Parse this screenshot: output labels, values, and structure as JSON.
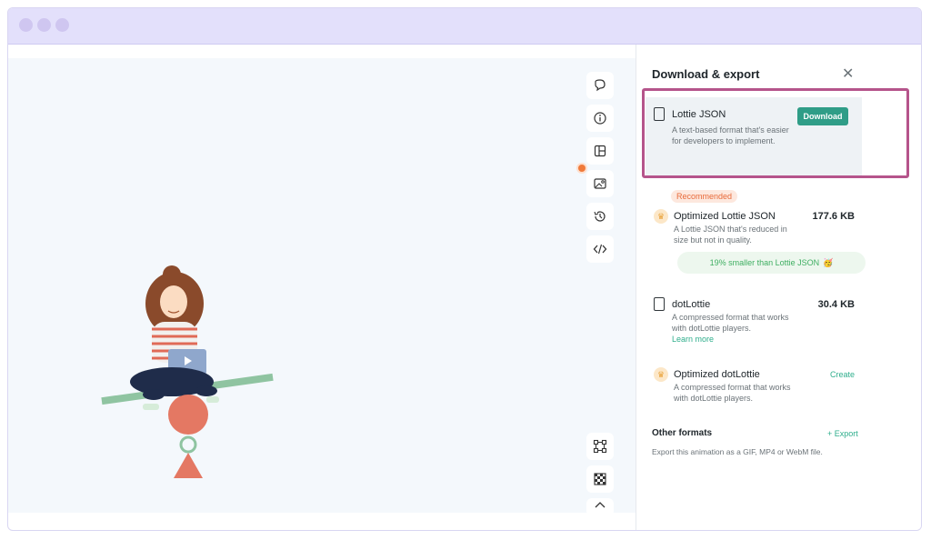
{
  "window": {
    "dots": [
      "traffic-light-close",
      "traffic-light-minimize",
      "traffic-light-maximize"
    ]
  },
  "colors": {
    "accent": "#2f9d87",
    "highlight": "#b5548b",
    "recommended": "#e86a3a",
    "titlebar": "#e3e0fb"
  },
  "toolbar": {
    "top_icons": [
      "comment-icon",
      "info-icon",
      "layout-icon",
      "image-settings-icon",
      "history-icon",
      "code-icon"
    ],
    "bottom_icons": [
      "bounding-box-icon",
      "transparency-grid-icon",
      "chevron-up-icon"
    ]
  },
  "panel": {
    "title": "Download & export",
    "close_icon": "close-icon",
    "lottie_json": {
      "title": "Lottie JSON",
      "description": "A text-based format that's easier for developers to implement.",
      "button": "Download"
    },
    "recommended_badge": "Recommended",
    "optimized_lottie": {
      "title": "Optimized Lottie JSON",
      "description": "A Lottie JSON that's reduced in size but not in quality.",
      "size": "177.6 KB",
      "banner": "19% smaller than Lottie JSON",
      "banner_emoji": "🥳"
    },
    "dotlottie": {
      "title": "dotLottie",
      "description": "A compressed format that works with dotLottie players.",
      "size": "30.4 KB",
      "link": "Learn more"
    },
    "optimized_dotlottie": {
      "title": "Optimized dotLottie",
      "description": "A compressed format that works with dotLottie players.",
      "action": "Create"
    },
    "other_formats": {
      "title": "Other formats",
      "action": "+ Export",
      "description": "Export this animation as a GIF, MP4 or WebM file."
    }
  }
}
